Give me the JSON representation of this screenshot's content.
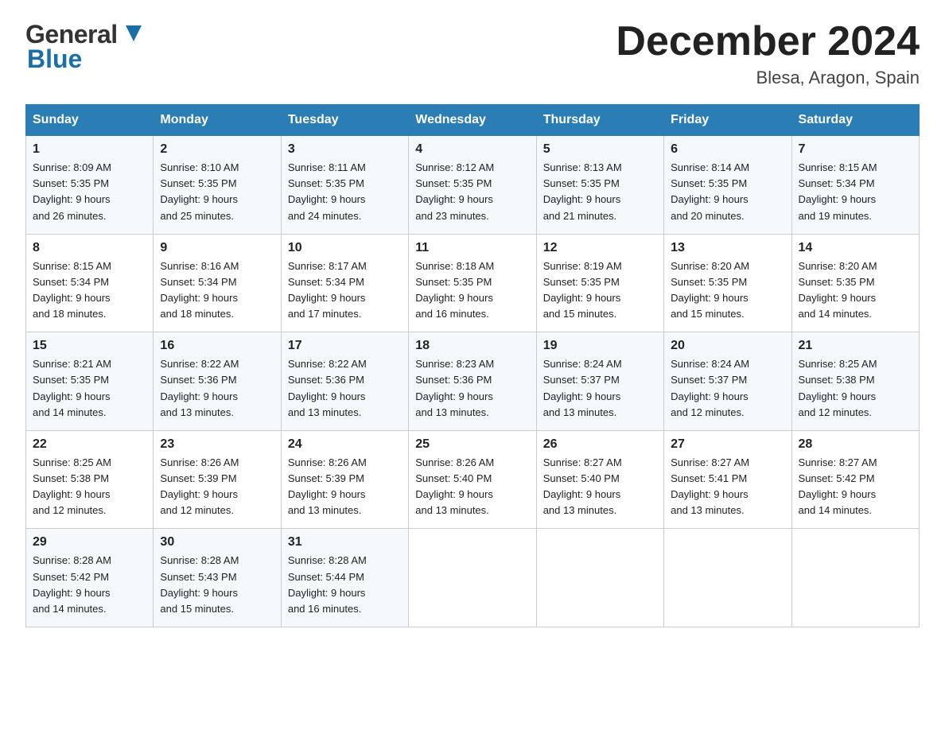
{
  "header": {
    "logo_general": "General",
    "logo_blue": "Blue",
    "month": "December 2024",
    "location": "Blesa, Aragon, Spain"
  },
  "days_of_week": [
    "Sunday",
    "Monday",
    "Tuesday",
    "Wednesday",
    "Thursday",
    "Friday",
    "Saturday"
  ],
  "weeks": [
    [
      {
        "day": "1",
        "sunrise": "8:09 AM",
        "sunset": "5:35 PM",
        "daylight": "9 hours and 26 minutes."
      },
      {
        "day": "2",
        "sunrise": "8:10 AM",
        "sunset": "5:35 PM",
        "daylight": "9 hours and 25 minutes."
      },
      {
        "day": "3",
        "sunrise": "8:11 AM",
        "sunset": "5:35 PM",
        "daylight": "9 hours and 24 minutes."
      },
      {
        "day": "4",
        "sunrise": "8:12 AM",
        "sunset": "5:35 PM",
        "daylight": "9 hours and 23 minutes."
      },
      {
        "day": "5",
        "sunrise": "8:13 AM",
        "sunset": "5:35 PM",
        "daylight": "9 hours and 21 minutes."
      },
      {
        "day": "6",
        "sunrise": "8:14 AM",
        "sunset": "5:35 PM",
        "daylight": "9 hours and 20 minutes."
      },
      {
        "day": "7",
        "sunrise": "8:15 AM",
        "sunset": "5:34 PM",
        "daylight": "9 hours and 19 minutes."
      }
    ],
    [
      {
        "day": "8",
        "sunrise": "8:15 AM",
        "sunset": "5:34 PM",
        "daylight": "9 hours and 18 minutes."
      },
      {
        "day": "9",
        "sunrise": "8:16 AM",
        "sunset": "5:34 PM",
        "daylight": "9 hours and 18 minutes."
      },
      {
        "day": "10",
        "sunrise": "8:17 AM",
        "sunset": "5:34 PM",
        "daylight": "9 hours and 17 minutes."
      },
      {
        "day": "11",
        "sunrise": "8:18 AM",
        "sunset": "5:35 PM",
        "daylight": "9 hours and 16 minutes."
      },
      {
        "day": "12",
        "sunrise": "8:19 AM",
        "sunset": "5:35 PM",
        "daylight": "9 hours and 15 minutes."
      },
      {
        "day": "13",
        "sunrise": "8:20 AM",
        "sunset": "5:35 PM",
        "daylight": "9 hours and 15 minutes."
      },
      {
        "day": "14",
        "sunrise": "8:20 AM",
        "sunset": "5:35 PM",
        "daylight": "9 hours and 14 minutes."
      }
    ],
    [
      {
        "day": "15",
        "sunrise": "8:21 AM",
        "sunset": "5:35 PM",
        "daylight": "9 hours and 14 minutes."
      },
      {
        "day": "16",
        "sunrise": "8:22 AM",
        "sunset": "5:36 PM",
        "daylight": "9 hours and 13 minutes."
      },
      {
        "day": "17",
        "sunrise": "8:22 AM",
        "sunset": "5:36 PM",
        "daylight": "9 hours and 13 minutes."
      },
      {
        "day": "18",
        "sunrise": "8:23 AM",
        "sunset": "5:36 PM",
        "daylight": "9 hours and 13 minutes."
      },
      {
        "day": "19",
        "sunrise": "8:24 AM",
        "sunset": "5:37 PM",
        "daylight": "9 hours and 13 minutes."
      },
      {
        "day": "20",
        "sunrise": "8:24 AM",
        "sunset": "5:37 PM",
        "daylight": "9 hours and 12 minutes."
      },
      {
        "day": "21",
        "sunrise": "8:25 AM",
        "sunset": "5:38 PM",
        "daylight": "9 hours and 12 minutes."
      }
    ],
    [
      {
        "day": "22",
        "sunrise": "8:25 AM",
        "sunset": "5:38 PM",
        "daylight": "9 hours and 12 minutes."
      },
      {
        "day": "23",
        "sunrise": "8:26 AM",
        "sunset": "5:39 PM",
        "daylight": "9 hours and 12 minutes."
      },
      {
        "day": "24",
        "sunrise": "8:26 AM",
        "sunset": "5:39 PM",
        "daylight": "9 hours and 13 minutes."
      },
      {
        "day": "25",
        "sunrise": "8:26 AM",
        "sunset": "5:40 PM",
        "daylight": "9 hours and 13 minutes."
      },
      {
        "day": "26",
        "sunrise": "8:27 AM",
        "sunset": "5:40 PM",
        "daylight": "9 hours and 13 minutes."
      },
      {
        "day": "27",
        "sunrise": "8:27 AM",
        "sunset": "5:41 PM",
        "daylight": "9 hours and 13 minutes."
      },
      {
        "day": "28",
        "sunrise": "8:27 AM",
        "sunset": "5:42 PM",
        "daylight": "9 hours and 14 minutes."
      }
    ],
    [
      {
        "day": "29",
        "sunrise": "8:28 AM",
        "sunset": "5:42 PM",
        "daylight": "9 hours and 14 minutes."
      },
      {
        "day": "30",
        "sunrise": "8:28 AM",
        "sunset": "5:43 PM",
        "daylight": "9 hours and 15 minutes."
      },
      {
        "day": "31",
        "sunrise": "8:28 AM",
        "sunset": "5:44 PM",
        "daylight": "9 hours and 16 minutes."
      },
      null,
      null,
      null,
      null
    ]
  ],
  "labels": {
    "sunrise": "Sunrise:",
    "sunset": "Sunset:",
    "daylight": "Daylight:"
  }
}
